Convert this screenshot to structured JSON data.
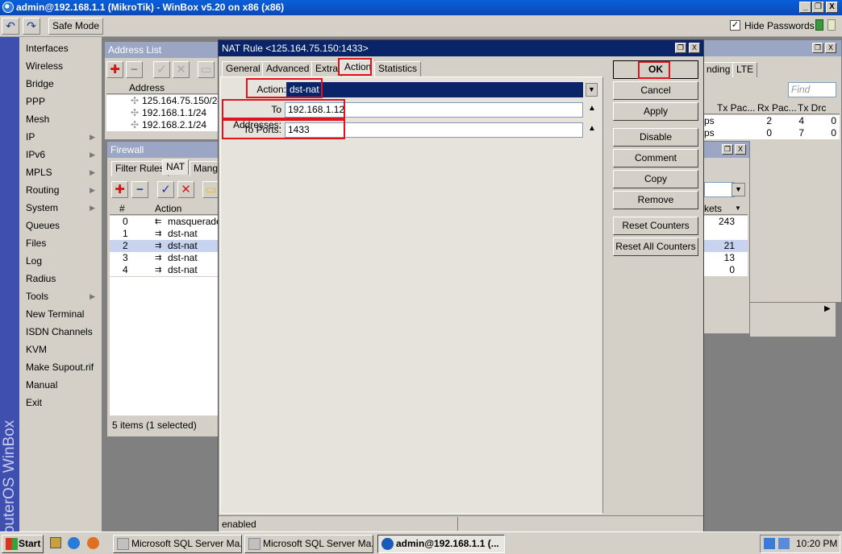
{
  "titlebar": {
    "title": "admin@192.168.1.1 (MikroTik) - WinBox v5.20 on x86 (x86)",
    "min": "_",
    "max": "❐",
    "close": "X"
  },
  "toolbar": {
    "undo_icon": "↶",
    "redo_icon": "↷",
    "safe_mode": "Safe Mode",
    "hide_passwords": "Hide Passwords",
    "hide_passwords_checked": true
  },
  "brand": "RouterOS WinBox",
  "menu": [
    {
      "label": "Interfaces",
      "arrow": ""
    },
    {
      "label": "Wireless",
      "arrow": ""
    },
    {
      "label": "Bridge",
      "arrow": ""
    },
    {
      "label": "PPP",
      "arrow": ""
    },
    {
      "label": "Mesh",
      "arrow": ""
    },
    {
      "label": "IP",
      "arrow": "▶"
    },
    {
      "label": "IPv6",
      "arrow": "▶"
    },
    {
      "label": "MPLS",
      "arrow": "▶"
    },
    {
      "label": "Routing",
      "arrow": "▶"
    },
    {
      "label": "System",
      "arrow": "▶"
    },
    {
      "label": "Queues",
      "arrow": ""
    },
    {
      "label": "Files",
      "arrow": ""
    },
    {
      "label": "Log",
      "arrow": ""
    },
    {
      "label": "Radius",
      "arrow": ""
    },
    {
      "label": "Tools",
      "arrow": "▶"
    },
    {
      "label": "New Terminal",
      "arrow": ""
    },
    {
      "label": "ISDN Channels",
      "arrow": ""
    },
    {
      "label": "KVM",
      "arrow": ""
    },
    {
      "label": "Make Supout.rif",
      "arrow": ""
    },
    {
      "label": "Manual",
      "arrow": ""
    },
    {
      "label": "Exit",
      "arrow": ""
    }
  ],
  "address_list": {
    "title": "Address List",
    "column": "Address",
    "rows": [
      "125.164.75.150/24",
      "192.168.1.1/24",
      "192.168.2.1/24"
    ]
  },
  "firewall": {
    "title": "Firewall",
    "tabs": [
      "Filter Rules",
      "NAT",
      "Mangl"
    ],
    "columns": [
      "#",
      "Action"
    ],
    "rows": [
      {
        "num": "0",
        "action": "masquerade"
      },
      {
        "num": "1",
        "action": "dst-nat"
      },
      {
        "num": "2",
        "action": "dst-nat"
      },
      {
        "num": "3",
        "action": "dst-nat"
      },
      {
        "num": "4",
        "action": "dst-nat"
      }
    ],
    "status": "5 items (1 selected)"
  },
  "interfaces_bg": {
    "tabs": [
      "nding",
      "LTE"
    ],
    "find_placeholder": "Find",
    "columns": [
      "Tx Pac...",
      "Rx Pac...",
      "Tx Drc"
    ],
    "rows": [
      {
        "c0": "ps",
        "c1": "2",
        "c2": "4",
        "c3": "0"
      },
      {
        "c0": "ps",
        "c1": "0",
        "c2": "7",
        "c3": "0"
      }
    ]
  },
  "nat_counts": {
    "column": "kets",
    "values": [
      "243",
      "",
      "21",
      "13",
      "0"
    ]
  },
  "nat_rule": {
    "title": "NAT Rule <125.164.75.150:1433>",
    "tabs": [
      "General",
      "Advanced",
      "Extra",
      "Action",
      "Statistics"
    ],
    "action_label": "Action:",
    "action_value": "dst-nat",
    "to_addresses_label": "To Addresses:",
    "to_addresses_value": "192.168.1.12",
    "to_ports_label": "To Ports:",
    "to_ports_value": "1433",
    "buttons": [
      "OK",
      "Cancel",
      "Apply",
      "Disable",
      "Comment",
      "Copy",
      "Remove",
      "Reset Counters",
      "Reset All Counters"
    ],
    "status": "enabled"
  },
  "taskbar": {
    "start": "Start",
    "tasks": [
      "Microsoft SQL Server Ma...",
      "Microsoft SQL Server Ma...",
      "admin@192.168.1.1 (..."
    ],
    "clock": "10:20 PM"
  }
}
